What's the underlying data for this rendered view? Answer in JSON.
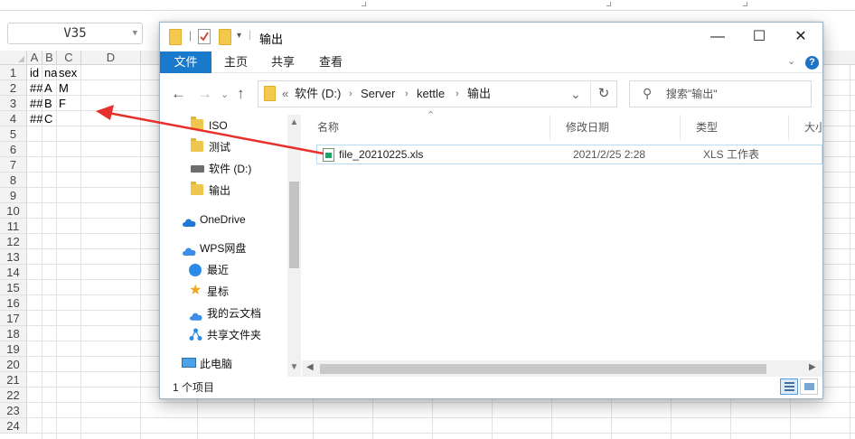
{
  "spreadsheet": {
    "name_box": "V35",
    "columns": [
      "A",
      "B",
      "C",
      "D"
    ],
    "rows": [
      "1",
      "2",
      "3",
      "4",
      "5",
      "6",
      "7",
      "8",
      "9",
      "10",
      "11",
      "12",
      "13",
      "14",
      "15",
      "16",
      "17",
      "18",
      "19",
      "20",
      "21",
      "22",
      "23",
      "24"
    ],
    "cells": {
      "A1": "id",
      "B1": "na",
      "C1": "sex",
      "A2": "##",
      "B2": "A",
      "C2": "M",
      "A3": "##",
      "B3": "B",
      "C3": "F",
      "A4": "##",
      "B4": "C"
    }
  },
  "explorer": {
    "title": "输出",
    "caption": {
      "minimize": "—",
      "maximize": "☐",
      "close": "✕"
    },
    "ribbon_tabs": [
      "文件",
      "主页",
      "共享",
      "查看"
    ],
    "address": {
      "overflow": "«",
      "segments": [
        "软件 (D:)",
        "Server",
        "kettle",
        "输出"
      ]
    },
    "search_placeholder": "搜索\"输出\"",
    "nav_items": [
      {
        "label": "ISO",
        "icon": "folder-icon"
      },
      {
        "label": "测试",
        "icon": "folder-icon"
      },
      {
        "label": "软件 (D:)",
        "icon": "drive-icon"
      },
      {
        "label": "输出",
        "icon": "folder-icon"
      },
      {
        "label": "OneDrive",
        "icon": "onedrive-icon"
      },
      {
        "label": "WPS网盘",
        "icon": "wps-cloud-icon"
      },
      {
        "label": "最近",
        "icon": "recent-icon"
      },
      {
        "label": "星标",
        "icon": "star-icon"
      },
      {
        "label": "我的云文档",
        "icon": "cloud-doc-icon"
      },
      {
        "label": "共享文件夹",
        "icon": "share-folder-icon"
      },
      {
        "label": "此电脑",
        "icon": "computer-icon"
      }
    ],
    "columns": [
      "名称",
      "修改日期",
      "类型",
      "大小"
    ],
    "files": [
      {
        "name": "file_20210225.xls",
        "modified": "2021/2/25 2:28",
        "type": "XLS 工作表",
        "size": ""
      }
    ],
    "status": "1 个项目",
    "accent": "#1979ca"
  },
  "annotation": {
    "arrow_color": "#e8302a"
  }
}
